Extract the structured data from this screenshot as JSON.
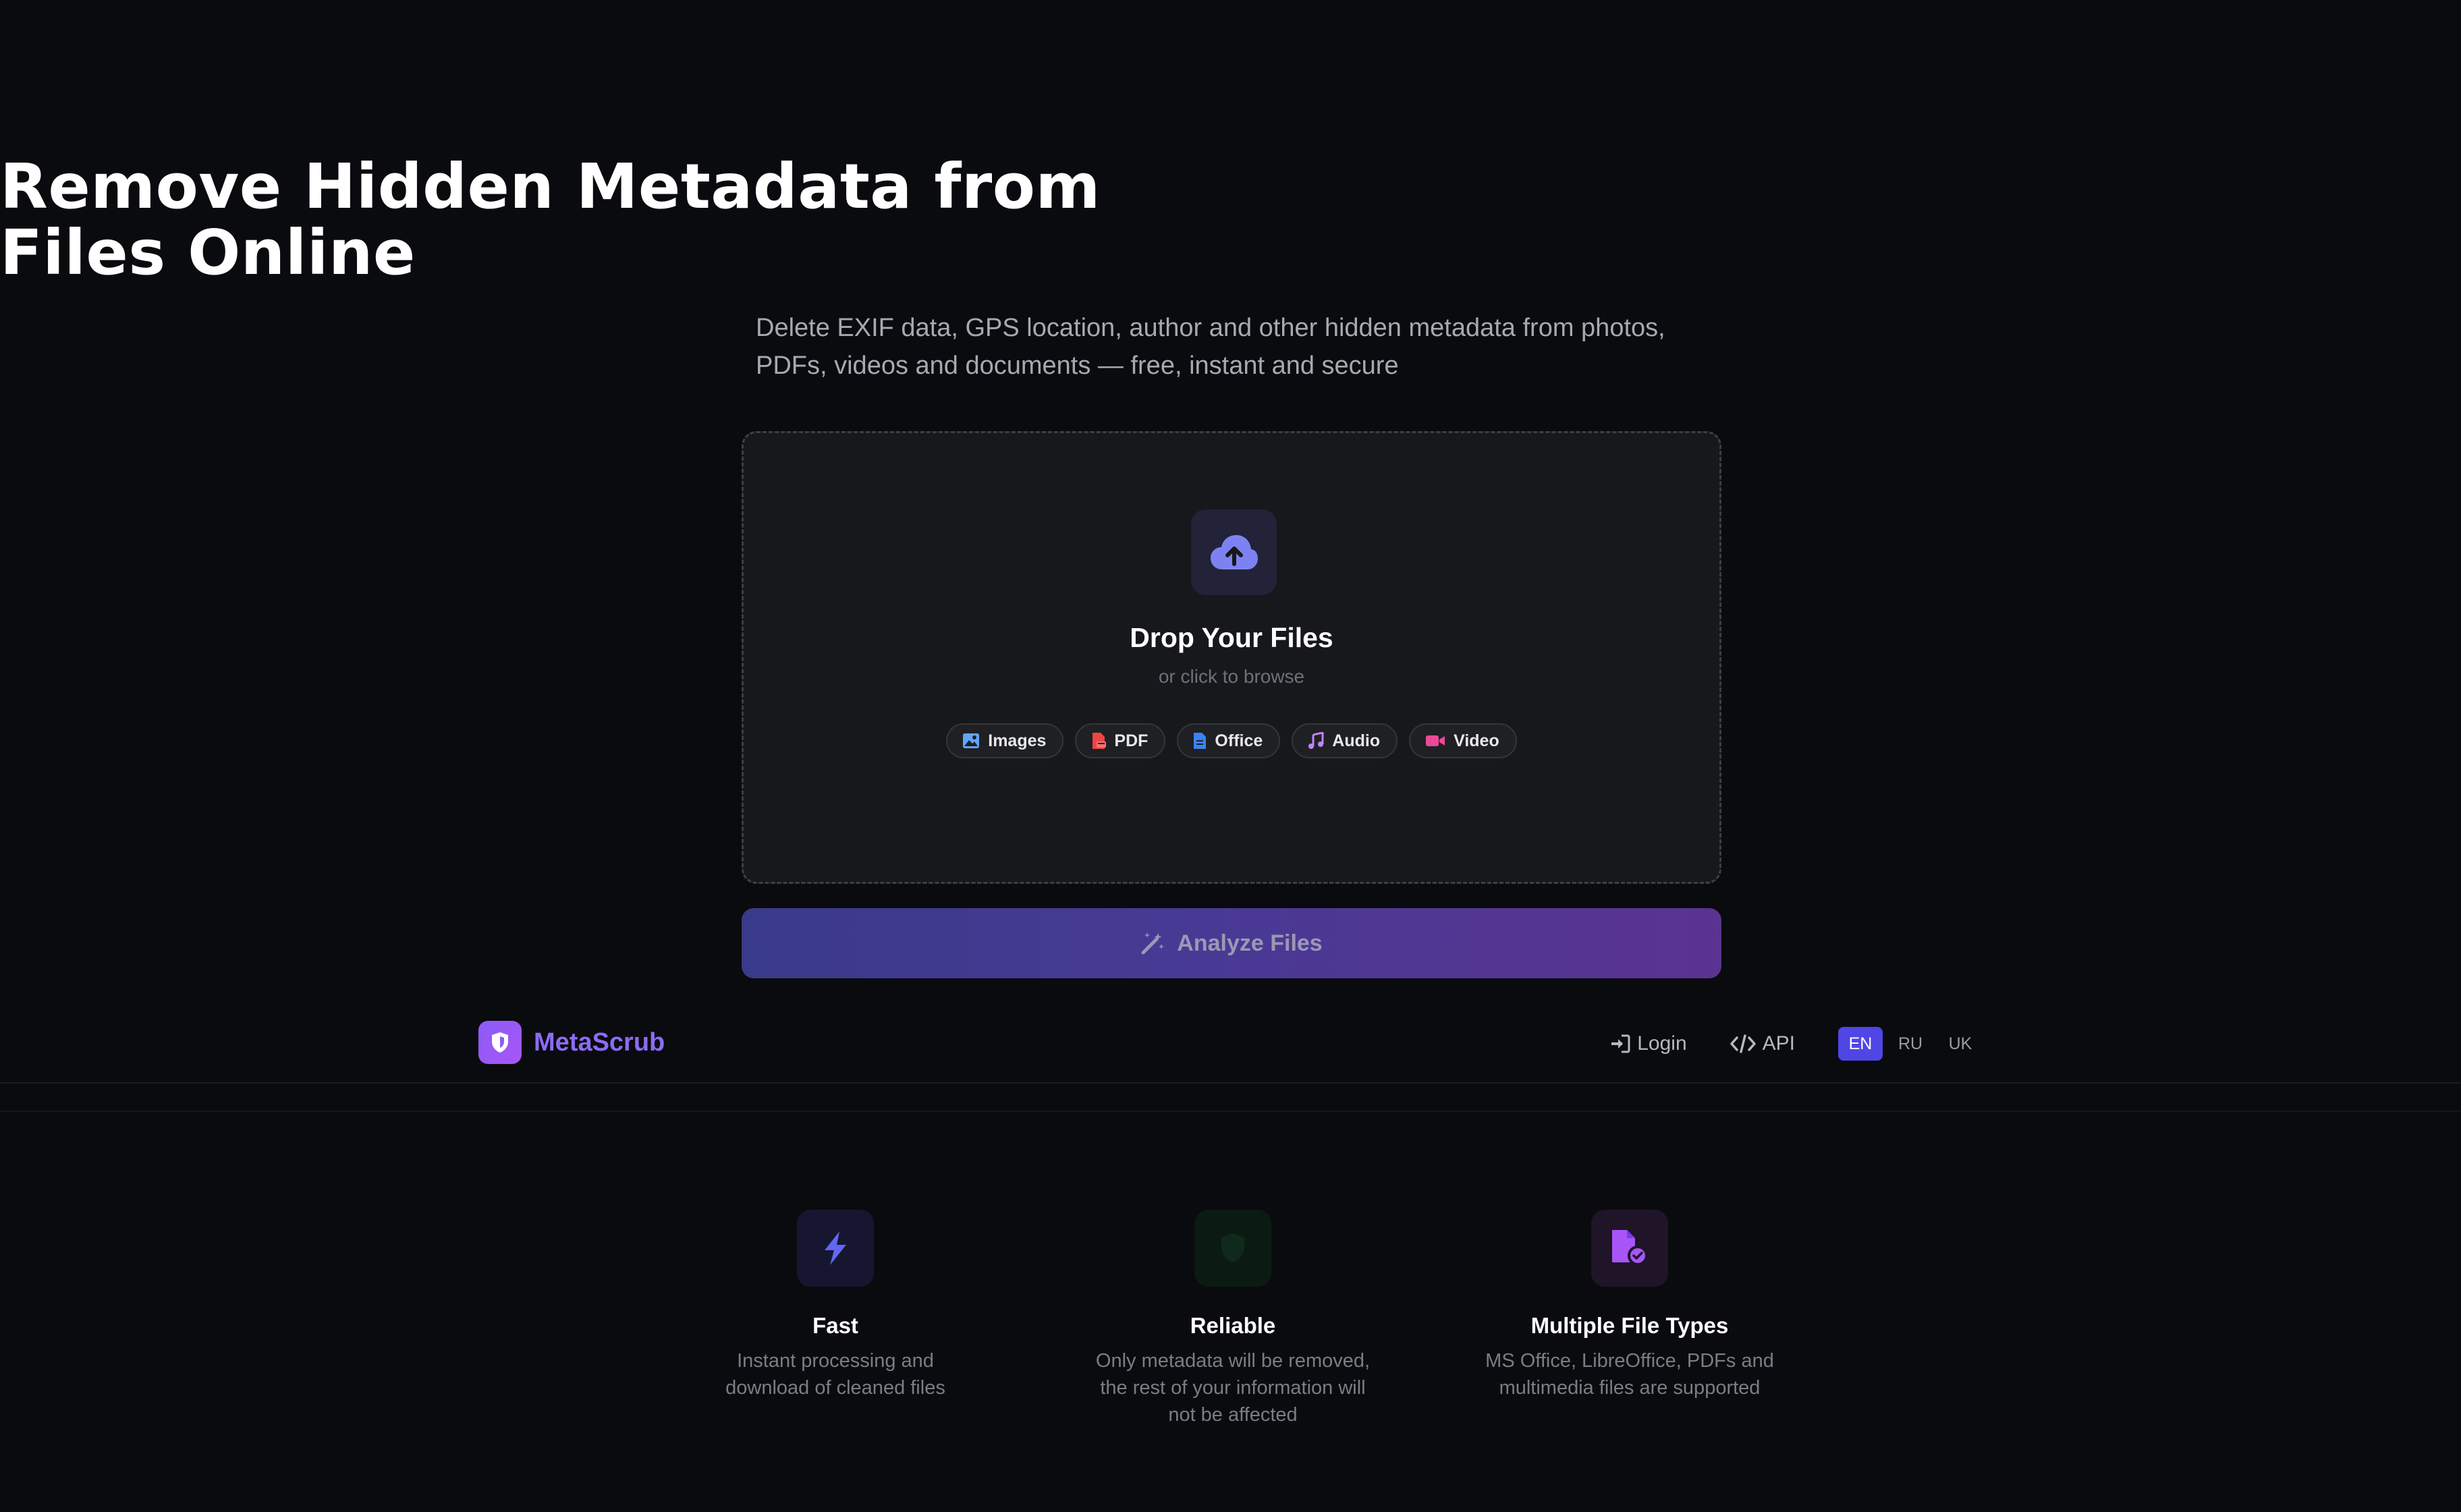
{
  "hero": {
    "title_line1": "Remove Hidden Metadata from",
    "title_line2": "Files Online",
    "subtitle_line1": "Delete EXIF data, GPS location, author and other hidden metadata from photos,",
    "subtitle_line2": "PDFs, videos and documents — free, instant and secure"
  },
  "dropzone": {
    "title": "Drop Your Files",
    "subtitle": "or click to browse",
    "icon": "cloud-upload-icon",
    "file_types": [
      {
        "label": "Images",
        "icon": "image-icon",
        "color": "#60a5fa"
      },
      {
        "label": "PDF",
        "icon": "pdf-file-icon",
        "color": "#ef4444"
      },
      {
        "label": "Office",
        "icon": "document-icon",
        "color": "#3b82f6"
      },
      {
        "label": "Audio",
        "icon": "music-note-icon",
        "color": "#c084fc"
      },
      {
        "label": "Video",
        "icon": "video-camera-icon",
        "color": "#ec4899"
      }
    ]
  },
  "analyze_button": {
    "label": "Analyze Files",
    "icon": "magic-wand-icon"
  },
  "nav": {
    "brand": "MetaScrub",
    "login": "Login",
    "api": "API",
    "languages": [
      {
        "code": "EN",
        "active": true
      },
      {
        "code": "RU",
        "active": false
      },
      {
        "code": "UK",
        "active": false
      }
    ]
  },
  "features": [
    {
      "title": "Fast",
      "desc_line1": "Instant processing and",
      "desc_line2": "download of cleaned files",
      "desc_line3": "",
      "icon": "lightning-icon",
      "color": "#6366f1"
    },
    {
      "title": "Reliable",
      "desc_line1": "Only metadata will be removed,",
      "desc_line2": "the rest of your information will",
      "desc_line3": "not be affected",
      "icon": "check-shield-icon",
      "color": "#10b981"
    },
    {
      "title": "Multiple File Types",
      "desc_line1": "MS Office, LibreOffice, PDFs and",
      "desc_line2": "multimedia files are supported",
      "desc_line3": "",
      "icon": "file-check-icon",
      "color": "#a855f7"
    }
  ],
  "colors": {
    "background": "#0a0b0e",
    "accent": "#4f46e5",
    "brand": "#8b6cf6"
  }
}
